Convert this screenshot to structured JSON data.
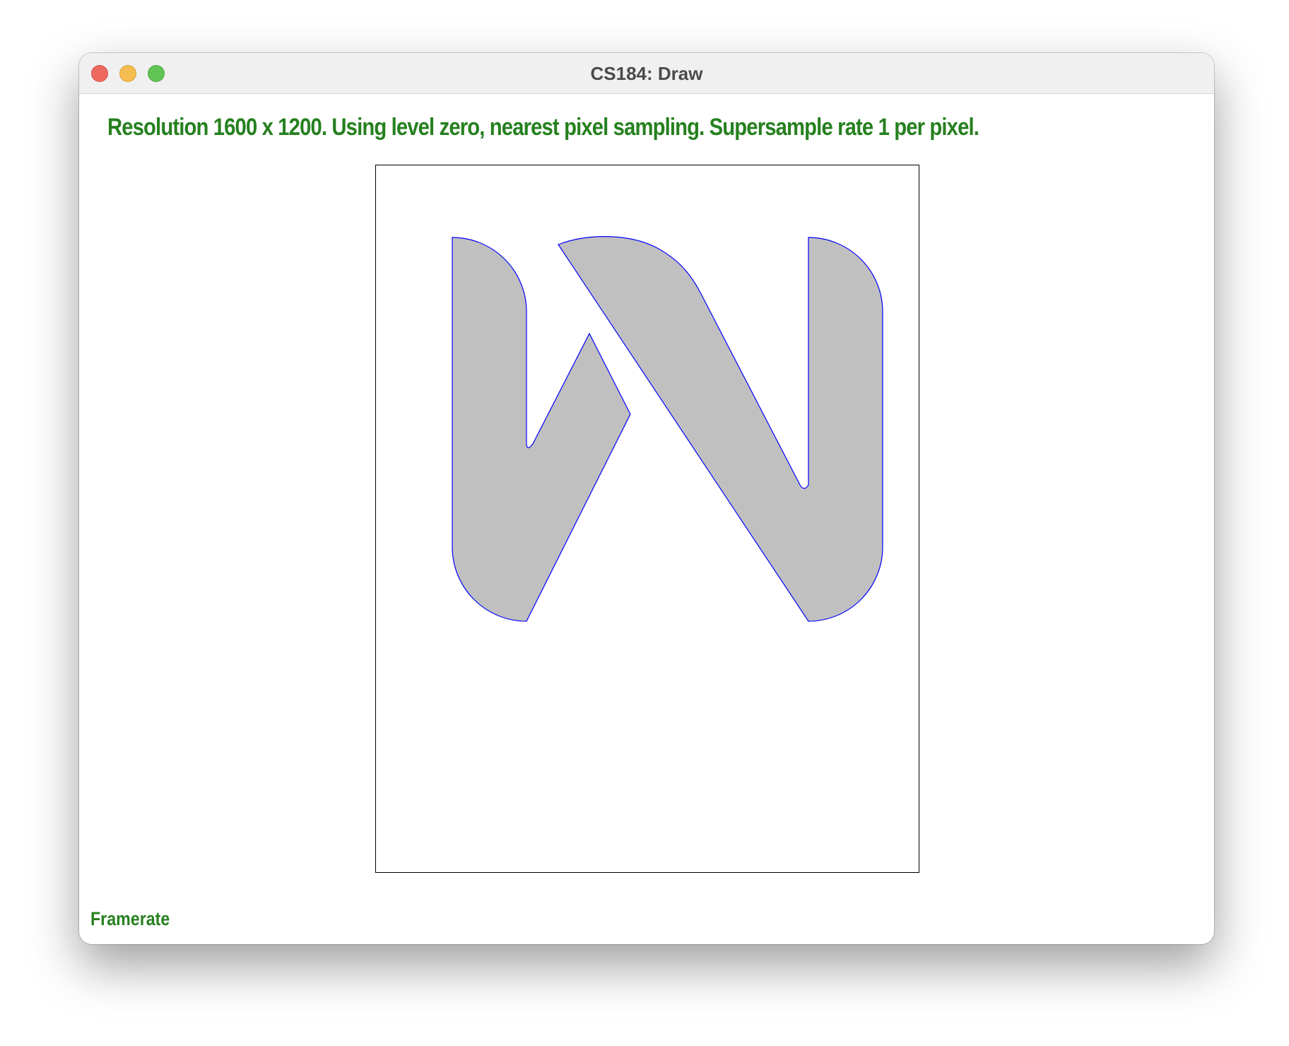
{
  "window": {
    "title": "CS184: Draw"
  },
  "status": {
    "text": "Resolution 1600 x 1200. Using level zero, nearest pixel sampling. Supersample rate 1 per pixel."
  },
  "footer": {
    "framerate_label": "Framerate"
  },
  "colors": {
    "status_text": "#26801f",
    "shape_fill": "#c0c0c0",
    "shape_outline": "#0000ff",
    "canvas_border": "#000000"
  }
}
